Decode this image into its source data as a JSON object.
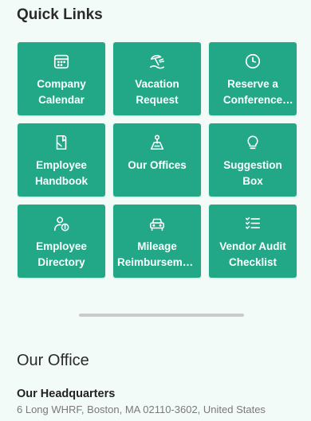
{
  "quick_links": {
    "title": "Quick Links",
    "tiles": [
      {
        "label": "Company Calendar",
        "icon": "calendar-icon"
      },
      {
        "label": "Vacation Request",
        "icon": "beach-umbrella-icon"
      },
      {
        "label": "Reserve a Conference Room",
        "icon": "clock-icon"
      },
      {
        "label": "Employee Handbook",
        "icon": "handbook-icon"
      },
      {
        "label": "Our Offices",
        "icon": "map-pin-icon"
      },
      {
        "label": "Suggestion Box",
        "icon": "lightbulb-icon"
      },
      {
        "label": "Employee Directory",
        "icon": "directory-icon"
      },
      {
        "label": "Mileage Reimbursement",
        "icon": "car-icon"
      },
      {
        "label": "Vendor Audit Checklist",
        "icon": "checklist-icon"
      }
    ]
  },
  "office": {
    "title": "Our Office",
    "hq_name": "Our Headquarters",
    "hq_address": "6 Long WHRF, Boston, MA 02110-3602, United States"
  },
  "colors": {
    "tile": "#22a887",
    "background": "#f3fbf9"
  }
}
